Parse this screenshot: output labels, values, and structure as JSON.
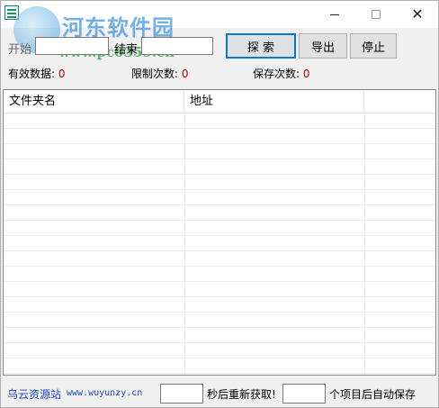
{
  "window": {
    "icon": "app-icon",
    "controls": {
      "minimize": "minimize-icon",
      "maximize": "maximize-icon",
      "close": "close-icon"
    }
  },
  "watermark": {
    "title": "河东软件园",
    "url": "www.pc0359.cn"
  },
  "controls": {
    "start_label": "开始",
    "start_value": "",
    "end_label": "结束",
    "end_value": "",
    "search_button": "探 索",
    "export_button": "导出",
    "stop_button": "停止"
  },
  "stats": {
    "valid_label": "有效数据:",
    "valid_value": "0",
    "limit_label": "限制次数:",
    "limit_value": "0",
    "save_label": "保存次数:",
    "save_value": "0"
  },
  "list": {
    "columns": [
      "文件夹名",
      "地址",
      ""
    ],
    "rows": []
  },
  "footer": {
    "site_name": "乌云资源站",
    "site_url": "www.wuyunzy.cn",
    "refresh_value": "",
    "refresh_text": "秒后重新获取!",
    "autosave_value": "",
    "autosave_text": "个项目后自动保存"
  }
}
